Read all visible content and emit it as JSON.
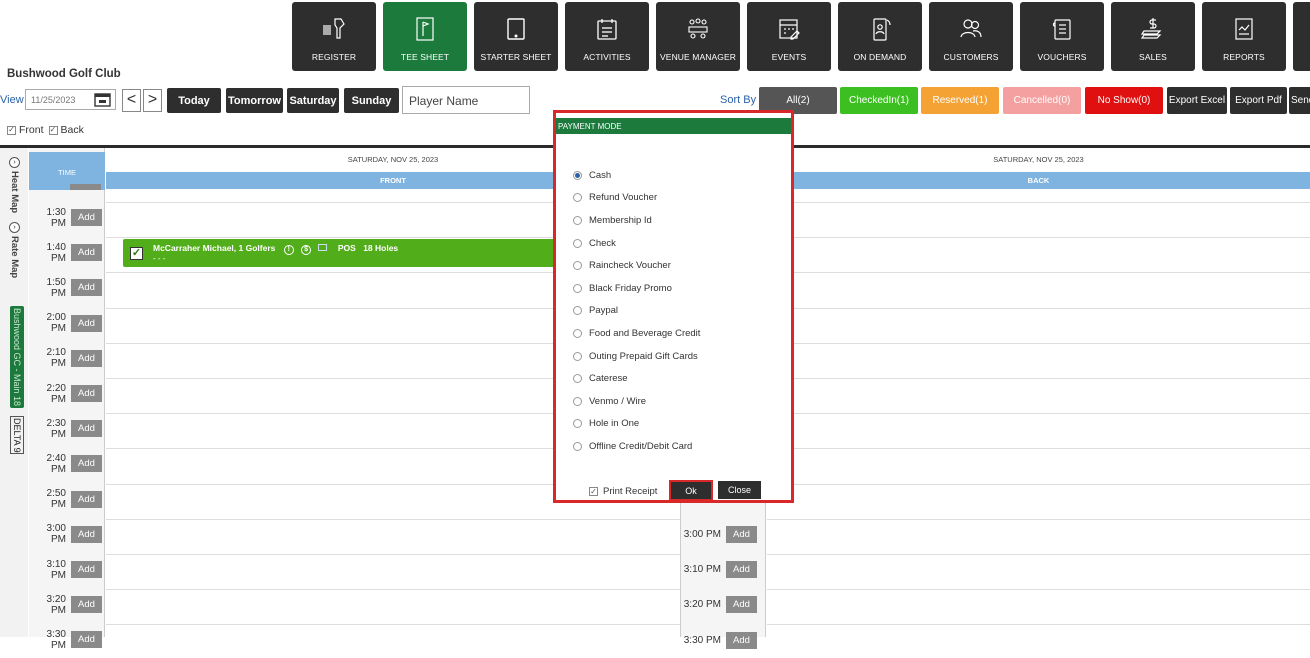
{
  "nav": [
    {
      "label": "REGISTER",
      "icon": "barcode-scanner-icon"
    },
    {
      "label": "TEE SHEET",
      "icon": "flag-icon"
    },
    {
      "label": "STARTER SHEET",
      "icon": "tablet-icon"
    },
    {
      "label": "ACTIVITIES",
      "icon": "calendar-list-icon"
    },
    {
      "label": "VENUE MANAGER",
      "icon": "people-meeting-icon"
    },
    {
      "label": "EVENTS",
      "icon": "calendar-edit-icon"
    },
    {
      "label": "ON DEMAND",
      "icon": "mobile-user-icon"
    },
    {
      "label": "CUSTOMERS",
      "icon": "users-icon"
    },
    {
      "label": "VOUCHERS",
      "icon": "voucher-icon"
    },
    {
      "label": "SALES",
      "icon": "cash-icon"
    },
    {
      "label": "REPORTS",
      "icon": "report-icon"
    }
  ],
  "club_name": "Bushwood Golf Club",
  "toolbar": {
    "view_label": "View",
    "date_value": "11/25/2023",
    "prev": "<",
    "next": ">",
    "today": "Today",
    "tomorrow": "Tomorrow",
    "saturday": "Saturday",
    "sunday": "Sunday",
    "player_placeholder": "Player Name",
    "sort_by": "Sort By",
    "filters": {
      "all": "All(2)",
      "checkedin": "CheckedIn(1)",
      "reserved": "Reserved(1)",
      "cancelled": "Cancelled(0)",
      "noshow": "No Show(0)"
    },
    "export_excel": "Export Excel",
    "export_pdf": "Export Pdf",
    "send": "Send"
  },
  "checks": {
    "front": "Front",
    "back": "Back"
  },
  "side": {
    "heat_map": "Heat Map",
    "rate_map": "Rate Map",
    "course": "Bushwood GC - Main 18",
    "delta": "DELTA 9"
  },
  "grid": {
    "time_header": "TIME",
    "front_date": "SATURDAY, NOV 25, 2023",
    "front_label": "FRONT",
    "back_date": "SATURDAY, NOV 25, 2023",
    "back_label": "BACK",
    "add_label": "Add",
    "times": [
      "1:30 PM",
      "1:40 PM",
      "1:50 PM",
      "2:00 PM",
      "2:10 PM",
      "2:20 PM",
      "2:30 PM",
      "2:40 PM",
      "2:50 PM",
      "3:00 PM",
      "3:10 PM",
      "3:20 PM",
      "3:30 PM"
    ],
    "back_times": [
      "3:00 PM",
      "3:10 PM",
      "3:20 PM",
      "3:30 PM"
    ]
  },
  "booking": {
    "text": "McCarraher Michael, 1 Golfers",
    "pos": "POS",
    "holes": "18 Holes",
    "sub": "- - -"
  },
  "modal": {
    "title": "PAYMENT MODE",
    "options": [
      "Cash",
      "Refund Voucher",
      "Membership Id",
      "Check",
      "Raincheck Voucher",
      "Black Friday Promo",
      "Paypal",
      "Food and Beverage Credit",
      "Outing Prepaid Gift Cards",
      "Caterese",
      "Venmo / Wire",
      "Hole in One",
      "Offline Credit/Debit Card"
    ],
    "selected_index": 0,
    "print_receipt": "Print Receipt",
    "ok": "Ok",
    "close": "Close"
  },
  "colors": {
    "green": "#1b7a3c",
    "booking_green": "#52ad1a",
    "checkedin": "#3bbf21",
    "reserved": "#f5a235",
    "cancelled": "#f4a0a0",
    "noshow": "#e01010",
    "header_blue": "#7fb4e0",
    "highlight_red": "#d9282a"
  }
}
